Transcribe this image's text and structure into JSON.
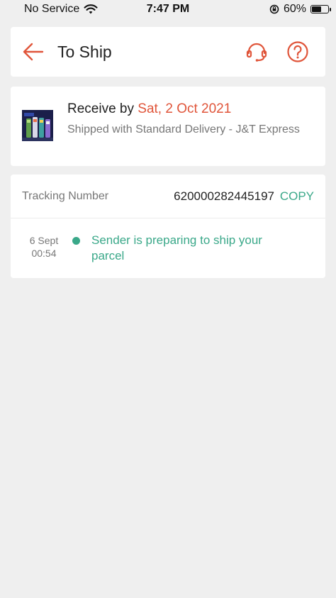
{
  "status_bar": {
    "carrier": "No Service",
    "time": "7:47 PM",
    "battery_percent": "60%",
    "battery_level": 0.6,
    "icons": [
      "wifi-icon",
      "orientation-lock-icon",
      "battery-icon"
    ]
  },
  "header": {
    "title": "To Ship",
    "icons": [
      "back-arrow-icon",
      "headset-icon",
      "help-icon"
    ]
  },
  "delivery": {
    "receive_prefix": "Receive by",
    "receive_date": "Sat, 2 Oct 2021",
    "shipping_info": "Shipped with Standard Delivery  - J&T Express"
  },
  "tracking": {
    "label": "Tracking Number",
    "number": "620000282445197",
    "copy_label": "COPY",
    "events": [
      {
        "date": "6 Sept",
        "time": "00:54",
        "text": "Sender is preparing to ship your parcel"
      }
    ]
  },
  "colors": {
    "accent": "#e0553a",
    "status_green": "#3aa889",
    "background": "#efefef"
  }
}
